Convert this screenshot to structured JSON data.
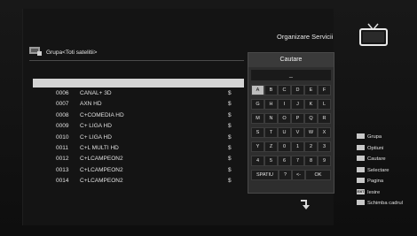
{
  "header": {
    "group_label": "Grupa<Toti satelitii>",
    "title": "Organizare Servicii"
  },
  "channels": [
    {
      "num": "0006",
      "name": "CANAL+ 3D",
      "flag": "$"
    },
    {
      "num": "0007",
      "name": "AXN HD",
      "flag": "$"
    },
    {
      "num": "0008",
      "name": "C+COMEDIA HD",
      "flag": "$"
    },
    {
      "num": "0009",
      "name": "C+ LIGA HD",
      "flag": "$"
    },
    {
      "num": "0010",
      "name": "C+ LIGA HD",
      "flag": "$"
    },
    {
      "num": "0011",
      "name": "C+L MULTI HD",
      "flag": "$"
    },
    {
      "num": "0012",
      "name": "C+LCAMPEON2",
      "flag": "$"
    },
    {
      "num": "0013",
      "name": "C+LCAMPEON2",
      "flag": "$"
    },
    {
      "num": "0014",
      "name": "C+LCAMPEON2",
      "flag": "$"
    }
  ],
  "keyboard": {
    "title": "Cautare",
    "field_value": "_",
    "rows": [
      [
        "A",
        "B",
        "C",
        "D",
        "E",
        "F"
      ],
      [
        "G",
        "H",
        "I",
        "J",
        "K",
        "L"
      ],
      [
        "M",
        "N",
        "O",
        "P",
        "Q",
        "R"
      ],
      [
        "S",
        "T",
        "U",
        "V",
        "W",
        "X"
      ],
      [
        "Y",
        "Z",
        "0",
        "1",
        "2",
        "3"
      ],
      [
        "4",
        "5",
        "6",
        "7",
        "8",
        "9"
      ]
    ],
    "bottom_row": [
      "SPATIU",
      "?",
      "<-",
      "OK"
    ],
    "selected_key": "A"
  },
  "legend": [
    {
      "key_color": "#c8c8c8",
      "key_text": "",
      "label": "Grupa"
    },
    {
      "key_color": "#c8c8c8",
      "key_text": "",
      "label": "Optiuni"
    },
    {
      "key_color": "#c8c8c8",
      "key_text": "",
      "label": "Cautare"
    },
    {
      "key_color": "#c8c8c8",
      "key_text": "",
      "label": "Selectare"
    },
    {
      "key_color": "#c8c8c8",
      "key_text": "",
      "label": "Pagina"
    },
    {
      "key_color": "#c8c8c8",
      "key_text": "EXIT",
      "label": "Iesire"
    },
    {
      "key_color": "#c8c8c8",
      "key_text": "",
      "label": "Schimba cadrul"
    }
  ],
  "icons": {
    "group": "satellite-dish-icon",
    "tv": "tv-icon",
    "nav": "arrow-turn-icon"
  }
}
